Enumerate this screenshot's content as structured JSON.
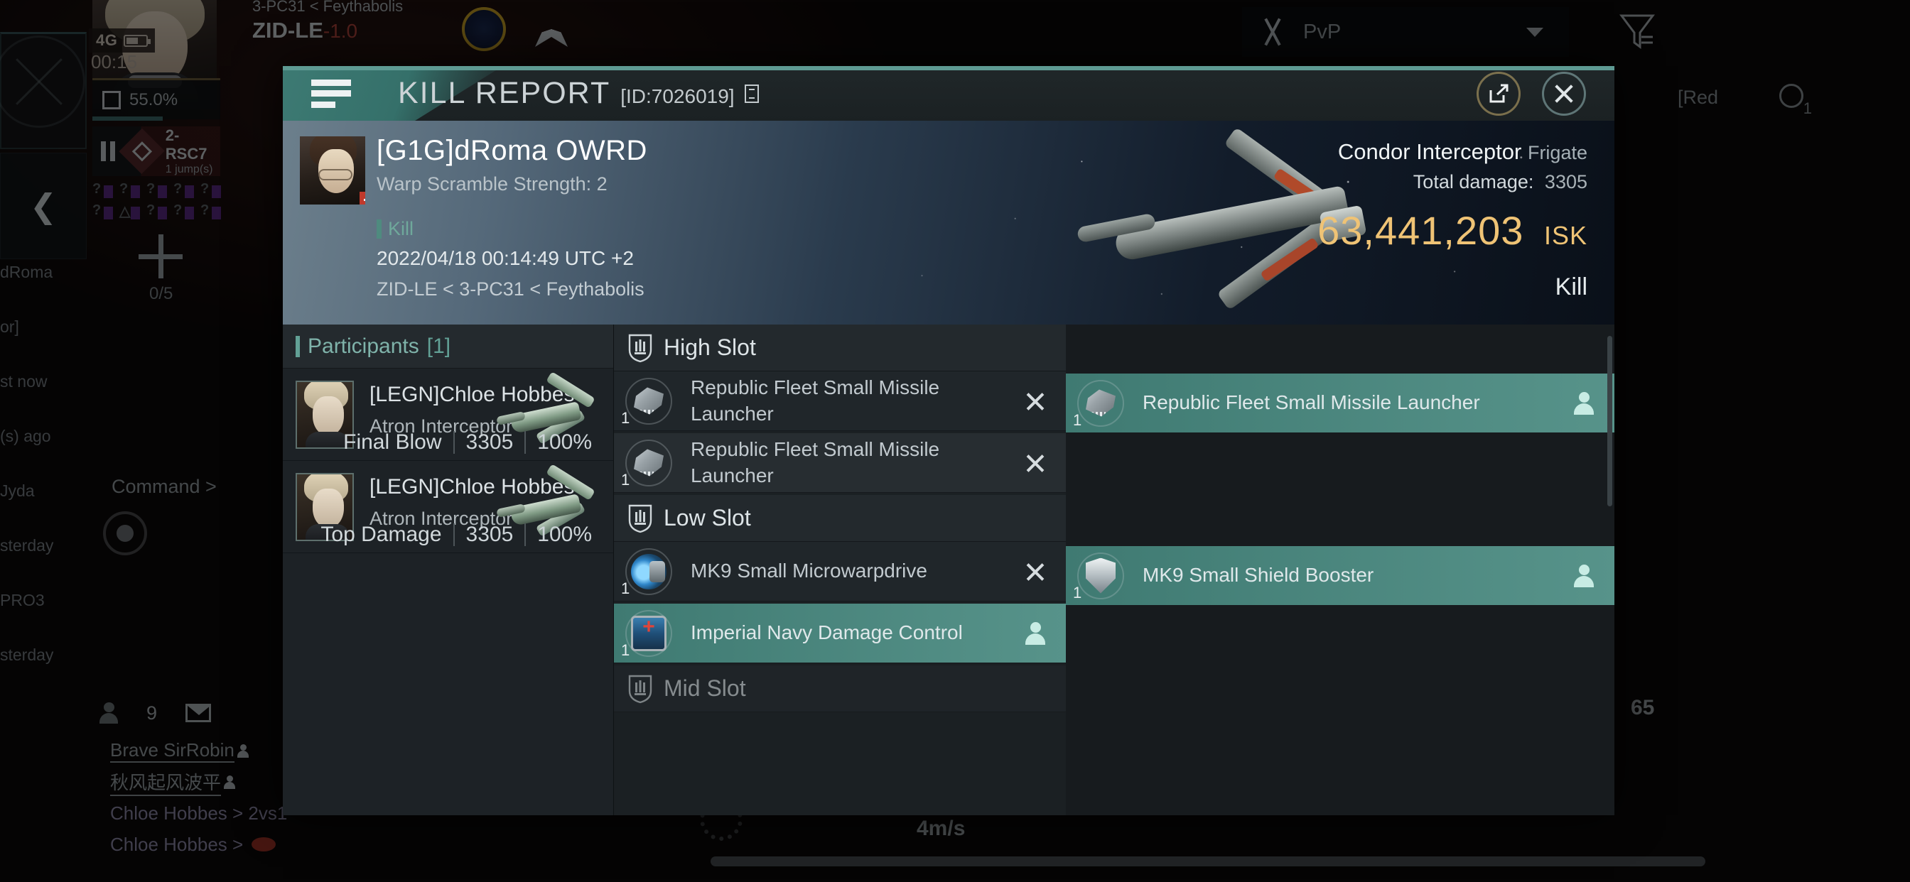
{
  "background": {
    "system_path_top": "3-PC31  < Feythabolis",
    "system_name": "ZID-LE",
    "system_sec": "-1.0",
    "network": "4G",
    "clock": "00:15",
    "cargo_pct": "55.0%",
    "route_system": "2-RSC7",
    "route_jumps": "1 jump(s)",
    "slot_count": "0/5",
    "command_label": "Command >",
    "side_notes": [
      "dRoma",
      "or]",
      "st now",
      "(s) ago",
      "Jyda",
      "sterday",
      "PRO3",
      "sterday"
    ],
    "pvp_label": "PvP",
    "red_label": "[Red",
    "search_count": "1",
    "chat_count": "9",
    "chat_rows": [
      {
        "text": "Brave SirRobin",
        "style": "link"
      },
      {
        "text": "秋风起风波平",
        "style": "link"
      },
      {
        "text": "Chloe Hobbes > 2vs1",
        "style": "msg"
      },
      {
        "text": "Chloe Hobbes >",
        "style": "msg"
      }
    ],
    "speed": "4m/s",
    "right_badge": "65",
    "topbar_right_num": "2-"
  },
  "modal": {
    "title": "KILL REPORT",
    "report_id": "[ID:7026019]",
    "hero": {
      "victim_name": "[G1G]dRoma OWRD",
      "victim_sub": "Warp Scramble Strength: 2",
      "kill_tag": "Kill",
      "timestamp": "2022/04/18 00:14:49 UTC +2",
      "location": "ZID-LE < 3-PC31 < Feythabolis",
      "ship_name": "Condor Interceptor",
      "ship_class": "Frigate",
      "total_damage_label": "Total damage:",
      "total_damage_value": "3305",
      "isk_value": "63,441,203",
      "isk_unit": "ISK",
      "result": "Kill"
    },
    "participants": {
      "header": "Participants",
      "count": "[1]",
      "rows": [
        {
          "name": "[LEGN]Chloe Hobbes",
          "ship": "Atron Interceptor",
          "stat_label": "Final Blow",
          "damage": "3305",
          "percent": "100%"
        },
        {
          "name": "[LEGN]Chloe Hobbes",
          "ship": "Atron Interceptor",
          "stat_label": "Top Damage",
          "damage": "3305",
          "percent": "100%"
        }
      ]
    },
    "fitting": {
      "sections": [
        {
          "title": "High Slot",
          "destroyed": [
            {
              "qty": "1",
              "name": "Republic Fleet Small Missile Launcher",
              "icon": "missile-launcher-icon",
              "action": "destroyed"
            },
            {
              "qty": "1",
              "name": "Republic Fleet Small Missile Launcher",
              "icon": "missile-launcher-icon",
              "action": "destroyed"
            }
          ],
          "dropped": [
            {
              "qty": "1",
              "name": "Republic Fleet Small Missile Launcher",
              "icon": "missile-launcher-icon",
              "action": "looted"
            }
          ]
        },
        {
          "title": "Low Slot",
          "destroyed": [
            {
              "qty": "1",
              "name": "MK9 Small Microwarpdrive",
              "icon": "microwarpdrive-icon",
              "action": "destroyed"
            },
            {
              "qty": "1",
              "name": "Imperial Navy Damage Control",
              "icon": "damage-control-icon",
              "action": "looted"
            }
          ],
          "dropped": [
            {
              "qty": "1",
              "name": "MK9 Small Shield Booster",
              "icon": "shield-booster-icon",
              "action": "looted"
            }
          ]
        },
        {
          "title": "Mid Slot",
          "destroyed": [],
          "dropped": []
        }
      ]
    }
  },
  "colors": {
    "accent_teal": "#5e9a93",
    "isk_gold": "#efc375",
    "highlight_green": "#4f8b7f"
  }
}
